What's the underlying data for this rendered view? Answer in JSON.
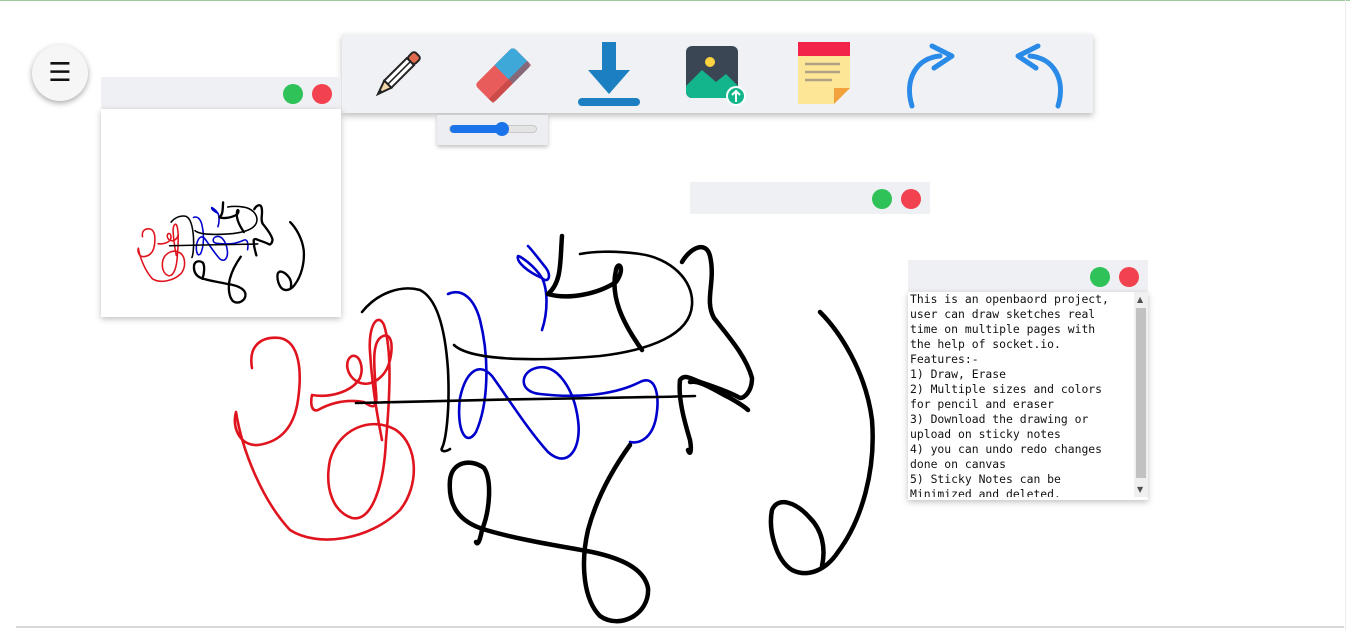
{
  "toolbar": {
    "tools": [
      {
        "name": "pencil",
        "icon": "pencil-icon"
      },
      {
        "name": "eraser",
        "icon": "eraser-icon"
      },
      {
        "name": "download",
        "icon": "download-icon"
      },
      {
        "name": "upload-image",
        "icon": "image-upload-icon"
      },
      {
        "name": "sticky-note",
        "icon": "sticky-note-icon"
      },
      {
        "name": "redo",
        "icon": "redo-icon"
      },
      {
        "name": "undo",
        "icon": "undo-icon"
      }
    ]
  },
  "menu": {
    "icon": "hamburger-icon",
    "glyph": "☰"
  },
  "size_slider": {
    "value": 0.6,
    "color": "#1a73e8"
  },
  "colors": {
    "black": "#000000",
    "blue": "#0000cc",
    "red": "#e0141e"
  },
  "sticky_note": {
    "text": "This is an openbaord project,\nuser can draw sketches real\ntime on multiple pages with\nthe help of socket.io.\nFeatures:-\n1) Draw, Erase\n2) Multiple sizes and colors\nfor pencil and eraser\n3) Download the drawing or\nupload on sticky notes\n4) you can undo redo changes\ndone on canvas\n5) Sticky Notes can be\nMinimized and deleted."
  }
}
